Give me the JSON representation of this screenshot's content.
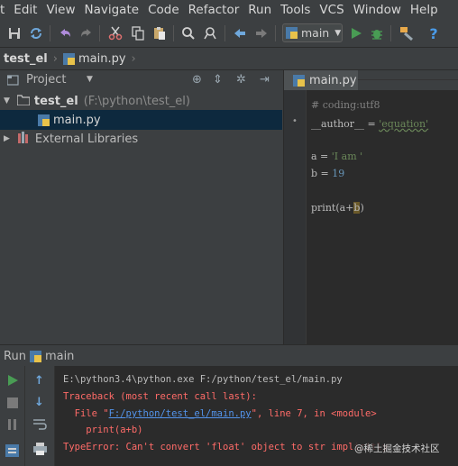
{
  "menu": [
    "t",
    "Edit",
    "View",
    "Navigate",
    "Code",
    "Refactor",
    "Run",
    "Tools",
    "VCS",
    "Window",
    "Help"
  ],
  "toolbar": {
    "run_config": "main"
  },
  "breadcrumb": {
    "project": "test_el",
    "file": "main.py"
  },
  "project_panel": {
    "title": "Project",
    "root_label": "test_el",
    "root_path": "(F:\\python\\test_el)",
    "file": "main.py",
    "external": "External Libraries"
  },
  "editor": {
    "tab": "main.py",
    "lines": {
      "comment": "# coding:utf8",
      "author_name": "__author__",
      "author_eq": " = ",
      "author_value": "'equation'",
      "a_assign": "a = ",
      "a_value": "'I am '",
      "b_assign": "b = ",
      "b_value": "19",
      "print_fn": "print(a+",
      "print_arg": "b",
      "print_close": ")"
    }
  },
  "run_panel": {
    "title": "Run",
    "config": "main",
    "console": {
      "cmd": "E:\\python3.4\\python.exe F:/python/test_el/main.py",
      "tb_header": "Traceback (most recent call last):",
      "file_prefix": "  File \"",
      "file_link": "F:/python/test_el/main.py",
      "file_suffix": "\", line 7, in <module>",
      "code_line": "    print(a+b)",
      "error": "TypeError: Can't convert 'float' object to str implicitly"
    }
  },
  "watermark": "@稀土掘金技术社区",
  "colors": {
    "background": "#3c3f41",
    "editor_bg": "#2b2b2b",
    "selection": "#0d293e",
    "error_red": "#ff6b68",
    "link_blue": "#5394ec",
    "string_green": "#6a8759",
    "number_blue": "#6897bb",
    "comment_gray": "#808080",
    "run_green": "#499c54"
  }
}
